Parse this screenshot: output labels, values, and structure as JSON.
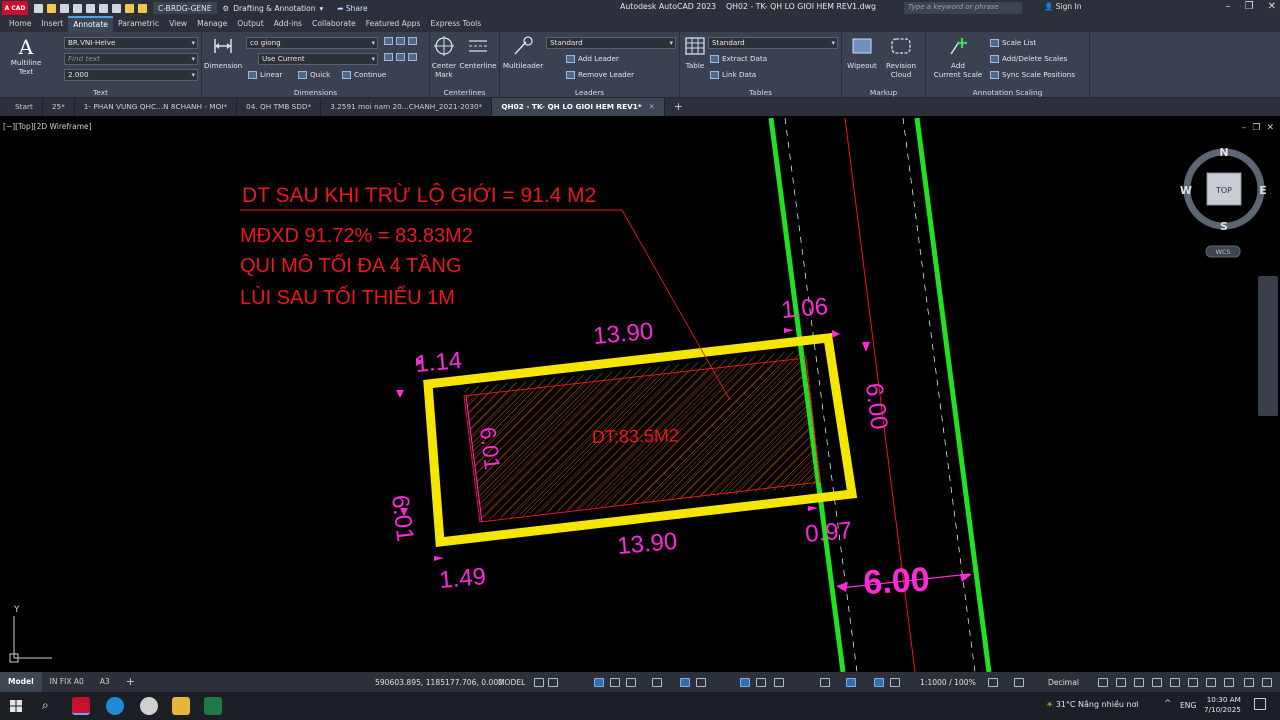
{
  "titlebar": {
    "app_badge": "A CAD",
    "layer_field": "C-BRDG-GENE",
    "workspace": "Drafting & Annotation",
    "share": "Share",
    "app_name": "Autodesk AutoCAD 2023",
    "file_name": "QH02 - TK- QH LO GIOI HEM REV1.dwg",
    "search_placeholder": "Type a keyword or phrase",
    "sign_in": "Sign In",
    "minimize": "–",
    "maximize": "❐",
    "close": "✕"
  },
  "ribbon_tabs": [
    "Home",
    "Insert",
    "Annotate",
    "Parametric",
    "View",
    "Manage",
    "Output",
    "Add-ins",
    "Collaborate",
    "Featured Apps",
    "Express Tools"
  ],
  "ribbon": {
    "text": {
      "title": "Text",
      "multiline": "Multiline",
      "multiline2": "Text",
      "style": "BR.VNI-Helve",
      "find": "Find text",
      "height": "2.000"
    },
    "dimensions": {
      "title": "Dimensions",
      "dimension": "Dimension",
      "style": "co giong",
      "layer": "Use Current",
      "linear": "Linear",
      "quick": "Quick",
      "continue": "Continue"
    },
    "centerlines": {
      "title": "Centerlines",
      "center_mark": "Center",
      "center_mark2": "Mark",
      "centerline": "Centerline"
    },
    "leaders": {
      "title": "Leaders",
      "multileader": "Multileader",
      "style": "Standard",
      "add": "Add Leader",
      "remove": "Remove Leader"
    },
    "tables": {
      "title": "Tables",
      "table": "Table",
      "style": "Standard",
      "extract": "Extract Data",
      "link": "Link Data"
    },
    "markup": {
      "title": "Markup",
      "wipeout": "Wipeout",
      "revision": "Revision",
      "revision2": "Cloud"
    },
    "scaling": {
      "title": "Annotation Scaling",
      "add": "Add",
      "add2": "Current Scale",
      "list": "Scale List",
      "add_delete": "Add/Delete Scales",
      "sync": "Sync Scale Positions"
    }
  },
  "doc_tabs": [
    {
      "label": "Start"
    },
    {
      "label": "25*"
    },
    {
      "label": "1- PHAN VUNG QHC...N 8CHANH - MOI*"
    },
    {
      "label": "04. QH TMB SDD*"
    },
    {
      "label": "3.2591 moi nam 20...CHANH_2021-2030*"
    },
    {
      "label": "QH02 - TK- QH LO GIOI HEM REV1*"
    }
  ],
  "viewport": {
    "label": "[−][Top][2D Wireframe]",
    "compass": {
      "n": "N",
      "s": "S",
      "e": "E",
      "w": "W",
      "top": "TOP",
      "wcs": "WCS"
    }
  },
  "drawing": {
    "note1": "DT SAU KHI TRỪ LỘ GIỚI = 91.4 M2",
    "note2": "MĐXD 91.72% = 83.83M2",
    "note3": "QUI MÔ TỐI ĐA 4 TẦNG",
    "note4": "LÙI SAU TỐI THIỂU 1M",
    "area": "DT:83.5M2",
    "dim_top": "13.90",
    "dim_bottom": "13.90",
    "dim_left_outer": "6.01",
    "dim_left_inner": "6.01",
    "dim_right": "6.00",
    "dim_114": "1.14",
    "dim_149": "1.49",
    "dim_106": "1.06",
    "dim_097": "0.97",
    "dim_road": "6.00",
    "ucs_y": "Y",
    "colors": {
      "lot": "#f5e600",
      "dim": "#ff2bd6",
      "note": "#e8191f",
      "road": "#22e022"
    }
  },
  "statusbar": {
    "layouts": [
      "Model",
      "IN FIX A0",
      "A3"
    ],
    "add": "+",
    "coords": "590603.895, 1185177.706, 0.000",
    "model": "MODEL",
    "scale": "1:1000 / 100%",
    "units": "Decimal"
  },
  "taskbar": {
    "temp": "31°C",
    "weather": "Nắng nhiều nơi",
    "lang": "ENG",
    "time": "10:30 AM",
    "date": "7/10/2025"
  }
}
